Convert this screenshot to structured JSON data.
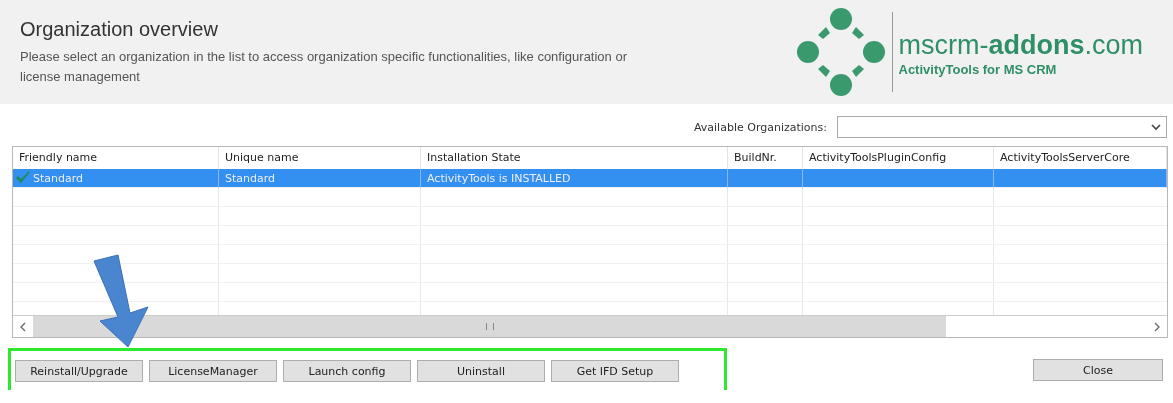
{
  "header": {
    "title": "Organization overview",
    "description": "Please select an organization in the list to access organization specific functionalities, like configuration or license management",
    "logo": {
      "brand": "mscrm-**addons**.com",
      "tagline": "ActivityTools for MS CRM"
    }
  },
  "org_selector": {
    "label": "Available Organizations:"
  },
  "table": {
    "columns": [
      "Friendly name",
      "Unique name",
      "Installation State",
      "BuildNr.",
      "ActivityToolsPluginConfig",
      "ActivityToolsServerCore"
    ],
    "rows": [
      {
        "selected": true,
        "installed": true,
        "cells": [
          "Standard",
          "Standard",
          "ActivityTools is INSTALLED",
          "",
          "",
          ""
        ]
      }
    ]
  },
  "action_buttons": [
    "Reinstall/Upgrade",
    "LicenseManager",
    "Launch config",
    "Uninstall",
    "Get IFD Setup"
  ],
  "highlight": {
    "kind": "frame"
  },
  "annotation": {
    "kind": "arrow"
  },
  "close_button": "Close"
}
